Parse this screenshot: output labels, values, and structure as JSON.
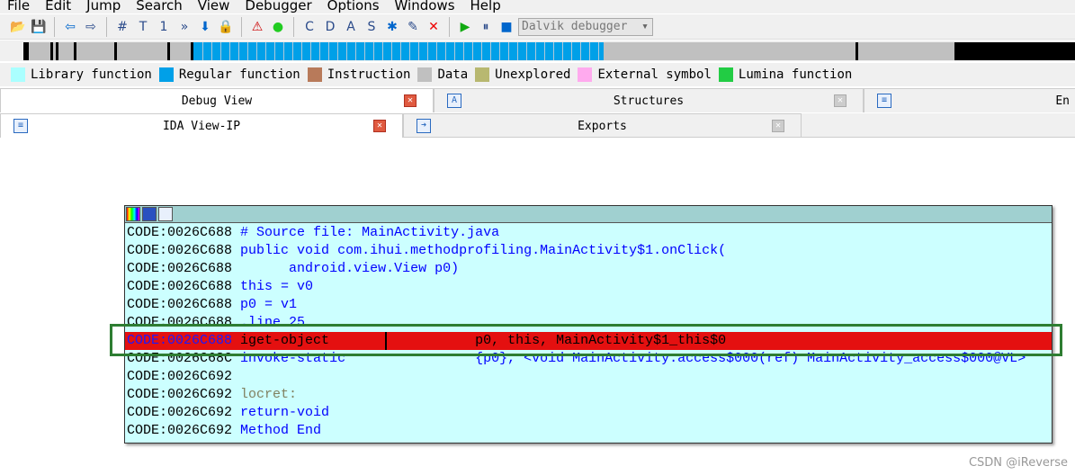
{
  "menu": [
    "File",
    "Edit",
    "Jump",
    "Search",
    "View",
    "Debugger",
    "Options",
    "Windows",
    "Help"
  ],
  "toolbar": {
    "debugger_select": "Dalvik debugger",
    "icons": [
      "open-icon",
      "save-icon",
      "back-icon",
      "forward-icon",
      "search-binary-icon",
      "search-text-icon",
      "search-immediate-icon",
      "search-next-icon",
      "jump-icon",
      "lock-icon",
      "warning-icon",
      "green-circle-icon",
      "create-code-icon",
      "create-data-icon",
      "create-ascii-icon",
      "create-struct-icon",
      "create-function-icon",
      "edit-icon",
      "delete-icon",
      "run-icon",
      "pause-icon",
      "stop-icon"
    ]
  },
  "legend": [
    {
      "label": "Library function",
      "color": "#aaffff"
    },
    {
      "label": "Regular function",
      "color": "#00a0e8"
    },
    {
      "label": "Instruction",
      "color": "#b87a5a"
    },
    {
      "label": "Data",
      "color": "#c0c0c0"
    },
    {
      "label": "Unexplored",
      "color": "#b8b870"
    },
    {
      "label": "External symbol",
      "color": "#ffaaee"
    },
    {
      "label": "Lumina function",
      "color": "#22cc44"
    }
  ],
  "tabs_row1": [
    "Debug View",
    "Structures",
    "En"
  ],
  "tabs_row2": [
    "IDA View-IP",
    "Exports"
  ],
  "code_lines": [
    {
      "addr": "CODE:0026C688",
      "text": "# Source file: MainActivity.java",
      "style": "kw"
    },
    {
      "addr": "CODE:0026C688",
      "text": "public void com.ihui.methodprofiling.MainActivity$1.onClick(",
      "style": "kw"
    },
    {
      "addr": "CODE:0026C688",
      "text": "      android.view.View p0)",
      "style": "kw"
    },
    {
      "addr": "CODE:0026C688",
      "text": "this = v0",
      "style": "kw"
    },
    {
      "addr": "CODE:0026C688",
      "text": "p0 = v1",
      "style": "kw"
    },
    {
      "addr": "CODE:0026C688",
      "text": ".line 25",
      "style": "kw"
    },
    {
      "addr": "CODE:0026C688",
      "text": "iget-object                  p0, this, MainActivity$1_this$0",
      "style": "kw",
      "highlight": true
    },
    {
      "addr": "CODE:0026C68C",
      "text": "invoke-static                {p0}, <void MainActivity.access$000(ref) MainActivity_access$000@VL>",
      "style": "kw"
    },
    {
      "addr": "CODE:0026C692",
      "text": "",
      "style": "kw"
    },
    {
      "addr": "CODE:0026C692",
      "text": "locret:",
      "style": "gray"
    },
    {
      "addr": "CODE:0026C692",
      "text": "return-void",
      "style": "kw"
    },
    {
      "addr": "CODE:0026C692",
      "text": "Method End",
      "style": "kw"
    }
  ],
  "watermark": "CSDN @iReverse"
}
